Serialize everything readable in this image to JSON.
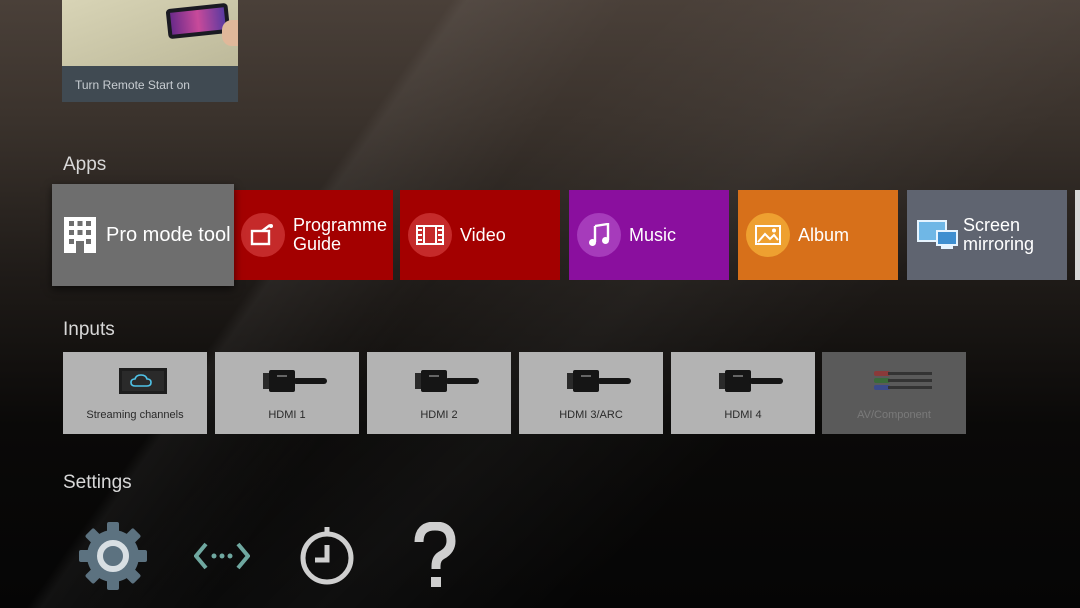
{
  "top_card": {
    "caption": "Turn Remote Start on"
  },
  "sections": {
    "apps": "Apps",
    "inputs": "Inputs",
    "settings": "Settings"
  },
  "apps": [
    {
      "label": "Pro mode tool",
      "icon": "building-icon",
      "color": "#6e6e6e"
    },
    {
      "label": "Programme Guide",
      "icon": "tv-guide-icon",
      "color": "#a30000"
    },
    {
      "label": "Video",
      "icon": "film-icon",
      "color": "#a30000"
    },
    {
      "label": "Music",
      "icon": "music-note-icon",
      "color": "#8a0f9e"
    },
    {
      "label": "Album",
      "icon": "picture-icon",
      "color": "#d7701a"
    },
    {
      "label": "Screen mirroring",
      "icon": "screen-mirroring-icon",
      "color": "#5f6470"
    }
  ],
  "inputs": [
    {
      "label": "Streaming channels",
      "icon": "cloud-tv-icon"
    },
    {
      "label": "HDMI 1",
      "icon": "hdmi-cable-icon"
    },
    {
      "label": "HDMI 2",
      "icon": "hdmi-cable-icon"
    },
    {
      "label": "HDMI 3/ARC",
      "icon": "hdmi-cable-icon"
    },
    {
      "label": "HDMI 4",
      "icon": "hdmi-cable-icon"
    },
    {
      "label": "AV/Component",
      "icon": "av-cable-icon",
      "disabled": true
    }
  ],
  "settings": [
    {
      "icon": "gear-icon"
    },
    {
      "icon": "network-arrows-icon"
    },
    {
      "icon": "timer-icon"
    },
    {
      "icon": "help-icon"
    }
  ]
}
